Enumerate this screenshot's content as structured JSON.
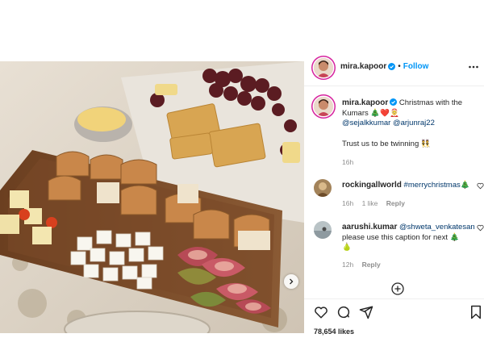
{
  "post": {
    "author": {
      "username": "mira.kapoor",
      "verified": true,
      "follow_label": "Follow",
      "separator": "•"
    },
    "caption": {
      "username": "mira.kapoor",
      "text_before": "Christmas with the Kumars",
      "emoji": "🎄❤️🤶",
      "mention_1": "@sejalkkumar",
      "mention_2": "@arjunraj22",
      "line2": "Trust us to be twinning",
      "line2_emoji": "👯",
      "time": "16h"
    },
    "comments": [
      {
        "username": "rockingallworld",
        "hashtag": "#merrychristmas",
        "emoji": "🎄",
        "time": "16h",
        "likes": "1 like",
        "reply_label": "Reply"
      },
      {
        "username": "aarushi.kumar",
        "mention": "@shweta_venkatesan",
        "text": "please use this caption for next",
        "emoji": "🎄",
        "emoji2": "🍐",
        "time": "12h",
        "reply_label": "Reply"
      }
    ],
    "likes_text": "78,654 likes"
  },
  "icons": {
    "more": "more-options-icon",
    "heart": "heart-icon",
    "comment": "comment-icon",
    "share": "share-icon",
    "save": "bookmark-icon",
    "load_more": "plus-circle-icon",
    "next": "chevron-right-icon",
    "verified": "verified-badge-icon"
  },
  "colors": {
    "link": "#00376b",
    "follow": "#0095f6",
    "verified": "#0095f6",
    "meta": "#8e8e8e"
  }
}
